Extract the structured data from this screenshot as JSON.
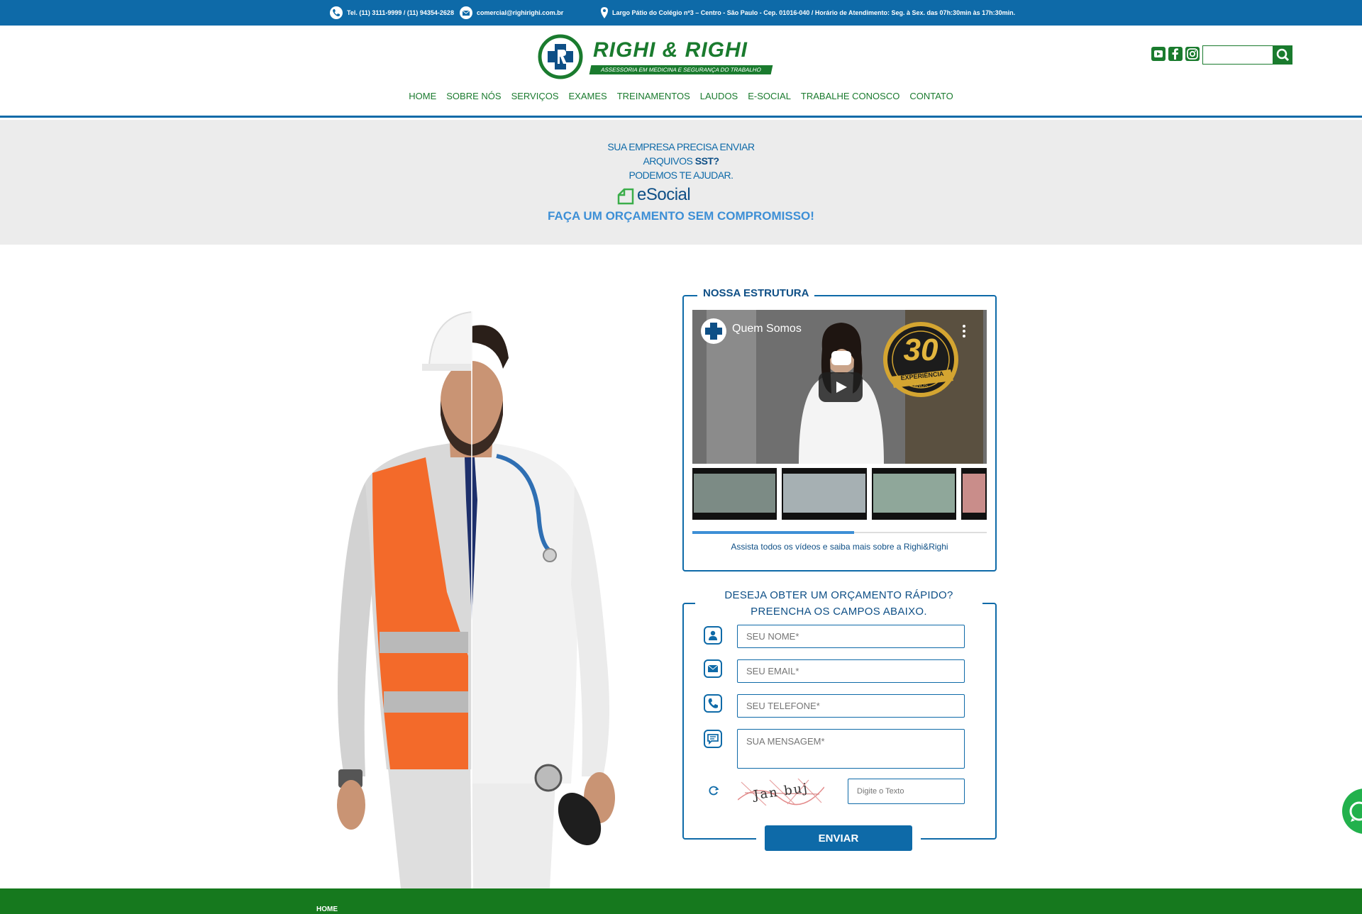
{
  "topbar": {
    "phone": "Tel. (11) 3111-9999 / (11) 94354-2628",
    "email": "comercial@righirighi.com.br",
    "address": "Largo Pátio do Colégio nº3 – Centro - São Paulo - Cep. 01016-040 / Horário de Atendimento: Seg. à Sex. das 07h:30min às 17h:30min."
  },
  "header": {
    "logo_name": "RIGHI & RIGHI",
    "logo_tagline": "ASSESSORIA EM MEDICINA E SEGURANÇA DO TRABALHO",
    "social_icons": [
      "youtube-icon",
      "facebook-icon",
      "instagram-icon"
    ],
    "search_placeholder": ""
  },
  "nav": [
    "HOME",
    "SOBRE NÓS",
    "SERVIÇOS",
    "EXAMES",
    "TREINAMENTOS",
    "LAUDOS",
    "E-SOCIAL",
    "TRABALHE CONOSCO",
    "CONTATO"
  ],
  "banner": {
    "line1": "SUA EMPRESA PRECISA ENVIAR",
    "line2_prefix": "ARQUIVOS ",
    "line2_bold": "SST?",
    "line3": "PODEMOS TE AJUDAR.",
    "esocial": "eSocial",
    "cta": "FAÇA UM ORÇAMENTO SEM COMPROMISSO!"
  },
  "videos": {
    "title": "NOSSA ESTRUTURA",
    "video_title": "Quem Somos",
    "badge_number": "30",
    "badge_word": "EXPERIÊNCIA",
    "badge_unit": "ANOS",
    "caption": "Assista todos os vídeos e saiba mais sobre a Righi&Righi",
    "progress": 0.55
  },
  "form": {
    "heading_line1": "DESEJA OBTER UM ORÇAMENTO RÁPIDO?",
    "heading_line2": "PREENCHA OS CAMPOS ABAIXO.",
    "name_placeholder": "SEU NOME*",
    "email_placeholder": "SEU EMAIL*",
    "phone_placeholder": "SEU TELEFONE*",
    "message_placeholder": "SUA MENSAGEM*",
    "captcha_placeholder": "Digite o Texto",
    "captcha_text": "Jan buj",
    "submit": "ENVIAR"
  },
  "footer": {
    "link": "HOME"
  },
  "colors": {
    "blue": "#0e6aa8",
    "green": "#1a7b2e",
    "light_blue": "#3d8fd6",
    "banner_bg": "#ececec"
  }
}
